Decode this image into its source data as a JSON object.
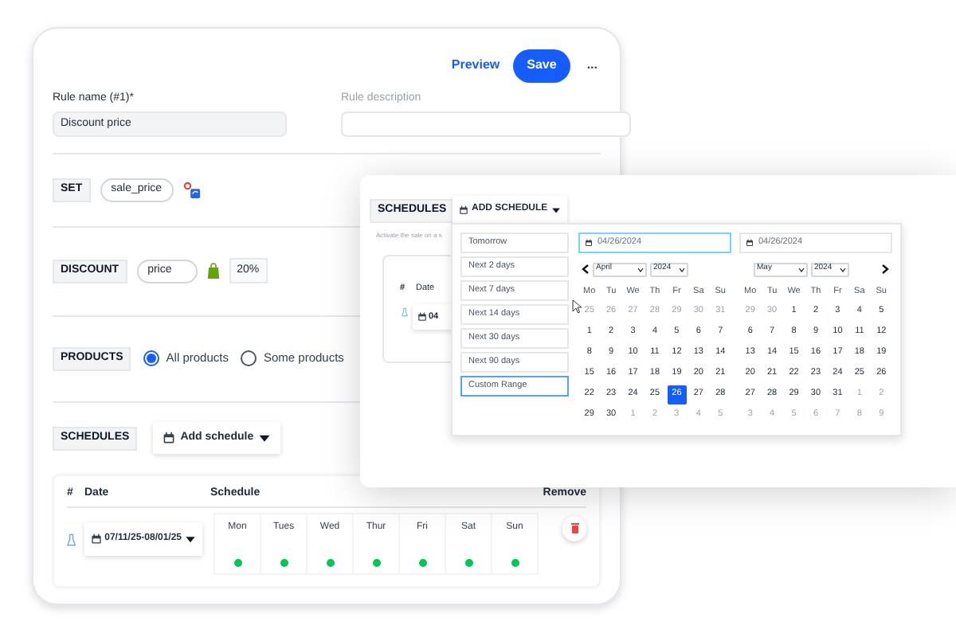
{
  "header": {
    "preview": "Preview",
    "save": "Save",
    "more": "..."
  },
  "rule_name": {
    "label": "Rule name (#1)*",
    "value": "Discount price"
  },
  "rule_description": {
    "label": "Rule description"
  },
  "set": {
    "tag": "SET",
    "field": "sale_price"
  },
  "discount": {
    "tag": "DISCOUNT",
    "field": "price",
    "amount": "20%"
  },
  "products": {
    "tag": "PRODUCTS",
    "options": [
      {
        "label": "All products",
        "selected": true
      },
      {
        "label": "Some products",
        "selected": false
      }
    ]
  },
  "schedules": {
    "tag": "SCHEDULES",
    "add_button": "Add schedule",
    "columns": [
      "#",
      "Date",
      "Schedule",
      "Remove"
    ],
    "rows": [
      {
        "date": "07/11/25-08/01/25",
        "days": [
          {
            "name": "Mon",
            "on": true
          },
          {
            "name": "Tues",
            "on": true
          },
          {
            "name": "Wed",
            "on": true
          },
          {
            "name": "Thur",
            "on": true
          },
          {
            "name": "Fri",
            "on": true
          },
          {
            "name": "Sat",
            "on": true
          },
          {
            "name": "Sun",
            "on": true
          }
        ]
      }
    ]
  },
  "overlay": {
    "tag": "SCHEDULES",
    "add_button": "ADD SCHEDULE",
    "hint": "Activate the sale on a s",
    "columns": [
      "#",
      "Date"
    ],
    "row_date": "04",
    "presets": [
      {
        "label": "Tomorrow",
        "selected": false
      },
      {
        "label": "Next 2 days",
        "selected": false
      },
      {
        "label": "Next 7 days",
        "selected": false
      },
      {
        "label": "Next 14 days",
        "selected": false
      },
      {
        "label": "Next 30 days",
        "selected": false
      },
      {
        "label": "Next 90 days",
        "selected": false
      },
      {
        "label": "Custom Range",
        "selected": true
      }
    ],
    "start_date": "04/26/2024",
    "end_date": "04/26/2024",
    "calendars": [
      {
        "month": "April",
        "year": "2024",
        "weekdays": [
          "Mo",
          "Tu",
          "We",
          "Th",
          "Fr",
          "Sa",
          "Su"
        ],
        "weeks": [
          [
            {
              "d": "25",
              "muted": true,
              "selected": false
            },
            {
              "d": "26",
              "muted": true,
              "selected": false
            },
            {
              "d": "27",
              "muted": true,
              "selected": false
            },
            {
              "d": "28",
              "muted": true,
              "selected": false
            },
            {
              "d": "29",
              "muted": true,
              "selected": false
            },
            {
              "d": "30",
              "muted": true,
              "selected": false
            },
            {
              "d": "31",
              "muted": true,
              "selected": false
            }
          ],
          [
            {
              "d": "1",
              "muted": false,
              "selected": false
            },
            {
              "d": "2",
              "muted": false,
              "selected": false
            },
            {
              "d": "3",
              "muted": false,
              "selected": false
            },
            {
              "d": "4",
              "muted": false,
              "selected": false
            },
            {
              "d": "5",
              "muted": false,
              "selected": false
            },
            {
              "d": "6",
              "muted": false,
              "selected": false
            },
            {
              "d": "7",
              "muted": false,
              "selected": false
            }
          ],
          [
            {
              "d": "8",
              "muted": false,
              "selected": false
            },
            {
              "d": "9",
              "muted": false,
              "selected": false
            },
            {
              "d": "10",
              "muted": false,
              "selected": false
            },
            {
              "d": "11",
              "muted": false,
              "selected": false
            },
            {
              "d": "12",
              "muted": false,
              "selected": false
            },
            {
              "d": "13",
              "muted": false,
              "selected": false
            },
            {
              "d": "14",
              "muted": false,
              "selected": false
            }
          ],
          [
            {
              "d": "15",
              "muted": false,
              "selected": false
            },
            {
              "d": "16",
              "muted": false,
              "selected": false
            },
            {
              "d": "17",
              "muted": false,
              "selected": false
            },
            {
              "d": "18",
              "muted": false,
              "selected": false
            },
            {
              "d": "19",
              "muted": false,
              "selected": false
            },
            {
              "d": "20",
              "muted": false,
              "selected": false
            },
            {
              "d": "21",
              "muted": false,
              "selected": false
            }
          ],
          [
            {
              "d": "22",
              "muted": false,
              "selected": false
            },
            {
              "d": "23",
              "muted": false,
              "selected": false
            },
            {
              "d": "24",
              "muted": false,
              "selected": false
            },
            {
              "d": "25",
              "muted": false,
              "selected": false
            },
            {
              "d": "26",
              "muted": false,
              "selected": true
            },
            {
              "d": "27",
              "muted": false,
              "selected": false
            },
            {
              "d": "28",
              "muted": false,
              "selected": false
            }
          ],
          [
            {
              "d": "29",
              "muted": false,
              "selected": false
            },
            {
              "d": "30",
              "muted": false,
              "selected": false
            },
            {
              "d": "1",
              "muted": true,
              "selected": false
            },
            {
              "d": "2",
              "muted": true,
              "selected": false
            },
            {
              "d": "3",
              "muted": true,
              "selected": false
            },
            {
              "d": "4",
              "muted": true,
              "selected": false
            },
            {
              "d": "5",
              "muted": true,
              "selected": false
            }
          ]
        ]
      },
      {
        "month": "May",
        "year": "2024",
        "weekdays": [
          "Mo",
          "Tu",
          "We",
          "Th",
          "Fr",
          "Sa",
          "Su"
        ],
        "weeks": [
          [
            {
              "d": "29",
              "muted": true,
              "selected": false
            },
            {
              "d": "30",
              "muted": true,
              "selected": false
            },
            {
              "d": "1",
              "muted": false,
              "selected": false
            },
            {
              "d": "2",
              "muted": false,
              "selected": false
            },
            {
              "d": "3",
              "muted": false,
              "selected": false
            },
            {
              "d": "4",
              "muted": false,
              "selected": false
            },
            {
              "d": "5",
              "muted": false,
              "selected": false
            }
          ],
          [
            {
              "d": "6",
              "muted": false,
              "selected": false
            },
            {
              "d": "7",
              "muted": false,
              "selected": false
            },
            {
              "d": "8",
              "muted": false,
              "selected": false
            },
            {
              "d": "9",
              "muted": false,
              "selected": false
            },
            {
              "d": "10",
              "muted": false,
              "selected": false
            },
            {
              "d": "11",
              "muted": false,
              "selected": false
            },
            {
              "d": "12",
              "muted": false,
              "selected": false
            }
          ],
          [
            {
              "d": "13",
              "muted": false,
              "selected": false
            },
            {
              "d": "14",
              "muted": false,
              "selected": false
            },
            {
              "d": "15",
              "muted": false,
              "selected": false
            },
            {
              "d": "16",
              "muted": false,
              "selected": false
            },
            {
              "d": "17",
              "muted": false,
              "selected": false
            },
            {
              "d": "18",
              "muted": false,
              "selected": false
            },
            {
              "d": "19",
              "muted": false,
              "selected": false
            }
          ],
          [
            {
              "d": "20",
              "muted": false,
              "selected": false
            },
            {
              "d": "21",
              "muted": false,
              "selected": false
            },
            {
              "d": "22",
              "muted": false,
              "selected": false
            },
            {
              "d": "23",
              "muted": false,
              "selected": false
            },
            {
              "d": "24",
              "muted": false,
              "selected": false
            },
            {
              "d": "25",
              "muted": false,
              "selected": false
            },
            {
              "d": "26",
              "muted": false,
              "selected": false
            }
          ],
          [
            {
              "d": "27",
              "muted": false,
              "selected": false
            },
            {
              "d": "28",
              "muted": false,
              "selected": false
            },
            {
              "d": "29",
              "muted": false,
              "selected": false
            },
            {
              "d": "30",
              "muted": false,
              "selected": false
            },
            {
              "d": "31",
              "muted": false,
              "selected": false
            },
            {
              "d": "1",
              "muted": true,
              "selected": false
            },
            {
              "d": "2",
              "muted": true,
              "selected": false
            }
          ],
          [
            {
              "d": "3",
              "muted": true,
              "selected": false
            },
            {
              "d": "4",
              "muted": true,
              "selected": false
            },
            {
              "d": "5",
              "muted": true,
              "selected": false
            },
            {
              "d": "6",
              "muted": true,
              "selected": false
            },
            {
              "d": "7",
              "muted": true,
              "selected": false
            },
            {
              "d": "8",
              "muted": true,
              "selected": false
            },
            {
              "d": "9",
              "muted": true,
              "selected": false
            }
          ]
        ]
      }
    ]
  }
}
